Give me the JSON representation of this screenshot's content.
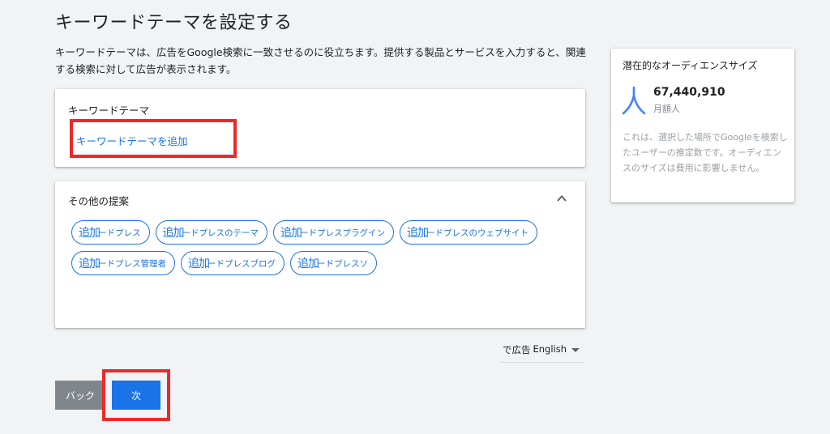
{
  "page": {
    "title": "キーワードテーマを設定する",
    "description": "キーワードテーマは、広告をGoogle検索に一致させるのに役立ちます。提供する製品とサービスを入力すると、関連する検索に対して広告が表示されます。"
  },
  "keyword_card": {
    "title": "キーワードテーマ",
    "add_link": "キーワードテーマを追加"
  },
  "suggestions": {
    "title": "その他の提案",
    "collapse_icon": "chevron-up-icon",
    "chips": [
      {
        "add": "追加",
        "text": "ードプレス"
      },
      {
        "add": "追加",
        "text": "ードプレスのテーマ"
      },
      {
        "add": "追加",
        "text": "ードプレスプラグイン"
      },
      {
        "add": "追加",
        "text": "ードプレスのウェブサイト"
      },
      {
        "add": "追加",
        "text": "ードプレス管理者"
      },
      {
        "add": "追加",
        "text": "ードプレスブログ"
      },
      {
        "add": "追加",
        "text": "ードプレスソ"
      }
    ]
  },
  "language": {
    "prefix": "で広告",
    "value": "English",
    "caret_icon": "caret-down-icon"
  },
  "buttons": {
    "back": "バック",
    "next": "次"
  },
  "audience": {
    "title": "潜在的なオーディエンスサイズ",
    "icon": "person-icon",
    "count": "67,440,910",
    "unit": "月額人",
    "note": "これは、選択した場所でGoogleを検索したユーザーの推定数です。オーディエンスのサイズは費用に影響しません。"
  },
  "colors": {
    "accent": "#1a73e8",
    "highlight": "#ea2a2a",
    "back_button": "#80868b",
    "background": "#f1f3f4"
  }
}
